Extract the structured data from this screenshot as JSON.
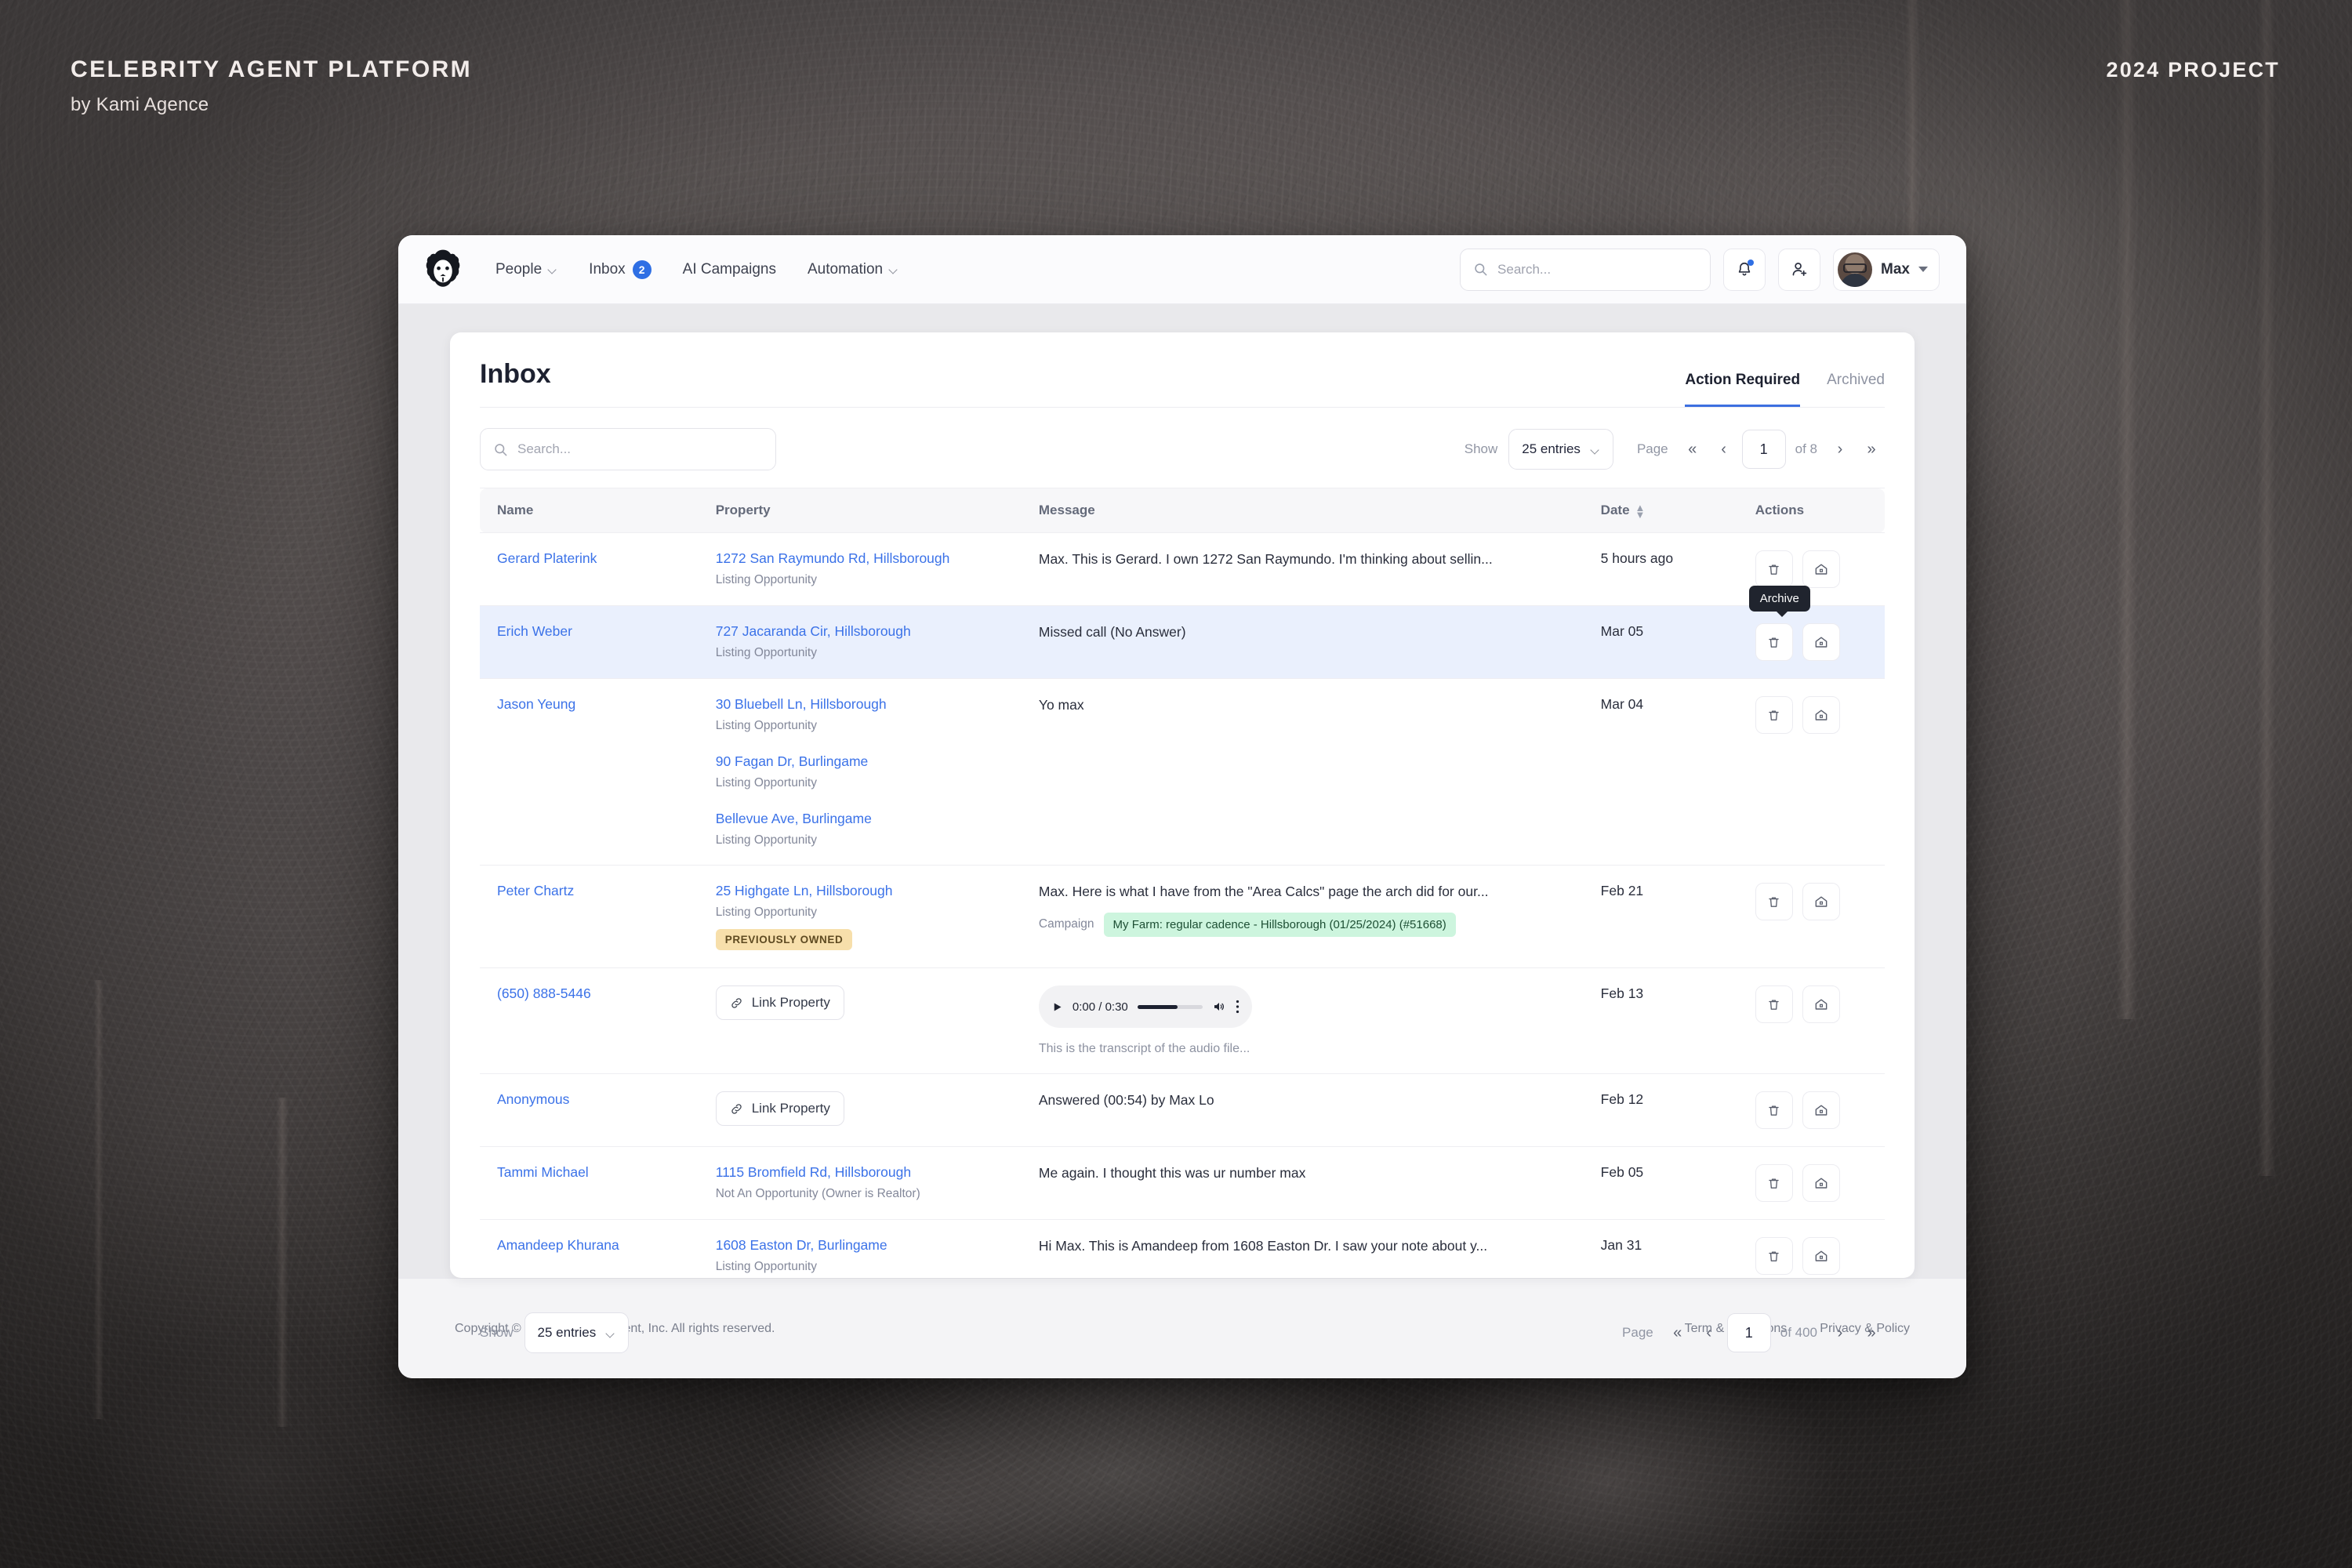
{
  "poster": {
    "title": "CELEBRITY AGENT PLATFORM",
    "subtitle": "by Kami Agence",
    "right_label": "2024 PROJECT"
  },
  "topnav": {
    "logo_name": "lion-logo",
    "links": [
      {
        "label": "People",
        "has_chevron": true
      },
      {
        "label": "Inbox",
        "badge": "2"
      },
      {
        "label": "AI Campaigns"
      },
      {
        "label": "Automation",
        "has_chevron": true
      }
    ],
    "search_placeholder": "Search...",
    "notifications_icon": "bell-icon",
    "add_user_icon": "add-user-icon",
    "user_name": "Max"
  },
  "page": {
    "title": "Inbox",
    "tabs": [
      {
        "label": "Action Required",
        "active": true
      },
      {
        "label": "Archived",
        "active": false
      }
    ]
  },
  "toolbar": {
    "search_placeholder": "Search...",
    "show_label": "Show",
    "entries_value": "25 entries",
    "page_label": "Page",
    "page_value": "1",
    "of_label": "of 8"
  },
  "table": {
    "columns": [
      "Name",
      "Property",
      "Message",
      "Date",
      "Actions"
    ],
    "rows": [
      {
        "name": "Gerard Platerink",
        "properties": [
          {
            "address": "1272 San Raymundo Rd, Hillsborough",
            "kind": "Listing Opportunity"
          }
        ],
        "message": "Max. This is Gerard. I own 1272 San Raymundo. I'm thinking about sellin...",
        "date": "5 hours ago",
        "highlight": false
      },
      {
        "name": "Erich Weber",
        "properties": [
          {
            "address": "727 Jacaranda Cir, Hillsborough",
            "kind": "Listing Opportunity"
          }
        ],
        "message": "Missed call (No Answer)",
        "date": "Mar 05",
        "highlight": true,
        "tooltip": "Archive"
      },
      {
        "name": "Jason Yeung",
        "properties": [
          {
            "address": "30 Bluebell Ln, Hillsborough",
            "kind": "Listing Opportunity"
          },
          {
            "address": "90 Fagan Dr, Burlingame",
            "kind": "Listing Opportunity"
          },
          {
            "address": "Bellevue Ave, Burlingame",
            "kind": "Listing Opportunity"
          }
        ],
        "message": "Yo max",
        "date": "Mar 04",
        "highlight": false
      },
      {
        "name": "Peter Chartz",
        "properties": [
          {
            "address": "25 Highgate Ln, Hillsborough",
            "kind": "Listing Opportunity",
            "badge": "PREVIOUSLY OWNED"
          }
        ],
        "message": "Max. Here is what I have from the \"Area Calcs\" page the arch did for our...",
        "campaign_label": "Campaign",
        "campaign_value": "My Farm: regular cadence - Hillsborough (01/25/2024) (#51668)",
        "date": "Feb 21",
        "highlight": false
      },
      {
        "name": "(650) 888-5446",
        "link_property_label": "Link Property",
        "audio": {
          "time": "0:00 / 0:30",
          "transcript": "This is the transcript of the audio file..."
        },
        "date": "Feb 13",
        "highlight": false
      },
      {
        "name": "Anonymous",
        "link_property_label": "Link Property",
        "message": "Answered (00:54) by Max Lo",
        "date": "Feb 12",
        "highlight": false
      },
      {
        "name": "Tammi Michael",
        "properties": [
          {
            "address": "1115 Bromfield Rd, Hillsborough",
            "kind": "Not An Opportunity (Owner is Realtor)"
          }
        ],
        "message": "Me again. I thought this was ur number max",
        "date": "Feb 05",
        "highlight": false
      },
      {
        "name": "Amandeep Khurana",
        "properties": [
          {
            "address": "1608 Easton Dr, Burlingame",
            "kind": "Listing Opportunity"
          }
        ],
        "message": "Hi Max. This is Amandeep from 1608 Easton Dr. I saw your note about y...",
        "date": "Jan 31",
        "highlight": false
      }
    ]
  },
  "bottom_toolbar": {
    "show_label": "Show",
    "entries_value": "25 entries",
    "page_label": "Page",
    "page_value": "1",
    "of_label": "of 400"
  },
  "footer": {
    "copyright": "Copyright © 2024 Celebrity Agent, Inc. All rights reserved.",
    "links": [
      "Term & Conditions",
      "Privacy & Policy"
    ]
  },
  "colors": {
    "accent_blue": "#3b72e8",
    "badge_blue": "#2f6fe4",
    "badge_amber_bg": "#f7dfab",
    "badge_green_bg": "#cdf5de",
    "row_highlight": "#eaf0fd",
    "poster_bg": "#6b5a58"
  }
}
